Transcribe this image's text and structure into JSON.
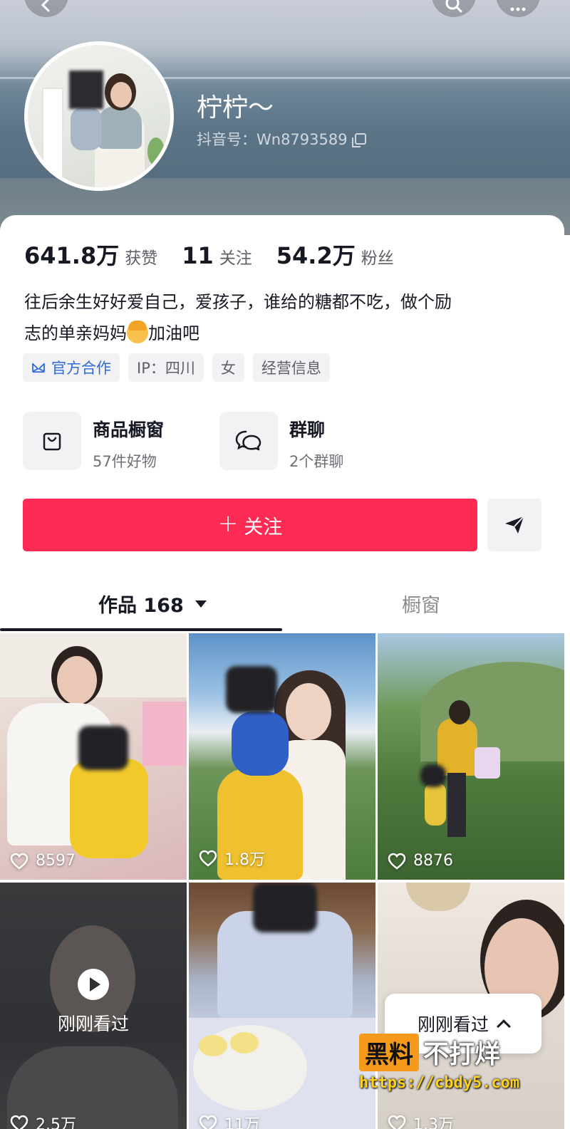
{
  "header": {
    "nickname": "柠柠～",
    "douyin_id": "抖音号：Wn8793589",
    "buttons": [
      "back-icon",
      "search-icon",
      "more-icon"
    ]
  },
  "stats": [
    {
      "value": "641.8万",
      "label": "获赞"
    },
    {
      "value": "11",
      "label": "关注"
    },
    {
      "value": "54.2万",
      "label": "粉丝"
    }
  ],
  "bio": {
    "line1": "往后余生好好爱自己，爱孩子，谁给的糖都不吃，做个励",
    "line2_before": "志的单亲妈妈",
    "line2_after": "加油吧",
    "emoji": "woman-emoji"
  },
  "tags": {
    "official": "官方合作",
    "ip": "IP：四川",
    "gender": "女",
    "business": "经营信息"
  },
  "shortcuts": [
    {
      "title": "商品橱窗",
      "sub": "57件好物",
      "icon": "shopping-bag-icon"
    },
    {
      "title": "群聊",
      "sub": "2个群聊",
      "icon": "chat-bubbles-icon"
    }
  ],
  "actions": {
    "follow": "关注",
    "share_icon": "send-icon"
  },
  "tabs": {
    "works": "作品 168",
    "window": "橱窗"
  },
  "videos": [
    {
      "likes": "8597"
    },
    {
      "likes": "1.8万"
    },
    {
      "likes": "8876"
    },
    {
      "likes": "2.5万",
      "overlay": "刚刚看过"
    },
    {
      "likes": "11万"
    },
    {
      "likes": "1.3万"
    }
  ],
  "recent_pill": "刚刚看过",
  "watermark": {
    "badge": "黑料",
    "rest": "不打烊",
    "url": "https://cbdy5.com"
  },
  "colors": {
    "follow_button": "#fe2c55",
    "official_tag": "#2f6ad8",
    "watermark_badge": "#f59a1b",
    "watermark_url": "#ffd21a"
  }
}
